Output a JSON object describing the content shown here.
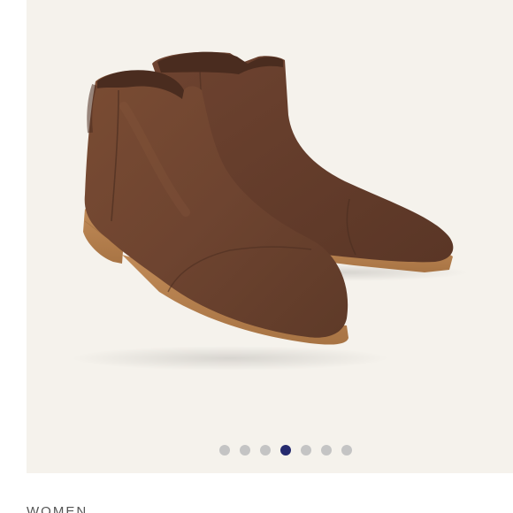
{
  "product": {
    "image_description": "brown-suede-ankle-boots",
    "category_label": "WOMEN"
  },
  "carousel": {
    "total_slides": 7,
    "active_index": 3,
    "colors": {
      "active_dot": "#252a6e",
      "inactive_dot": "#c4c4c4",
      "background": "#f5f2ec"
    }
  }
}
